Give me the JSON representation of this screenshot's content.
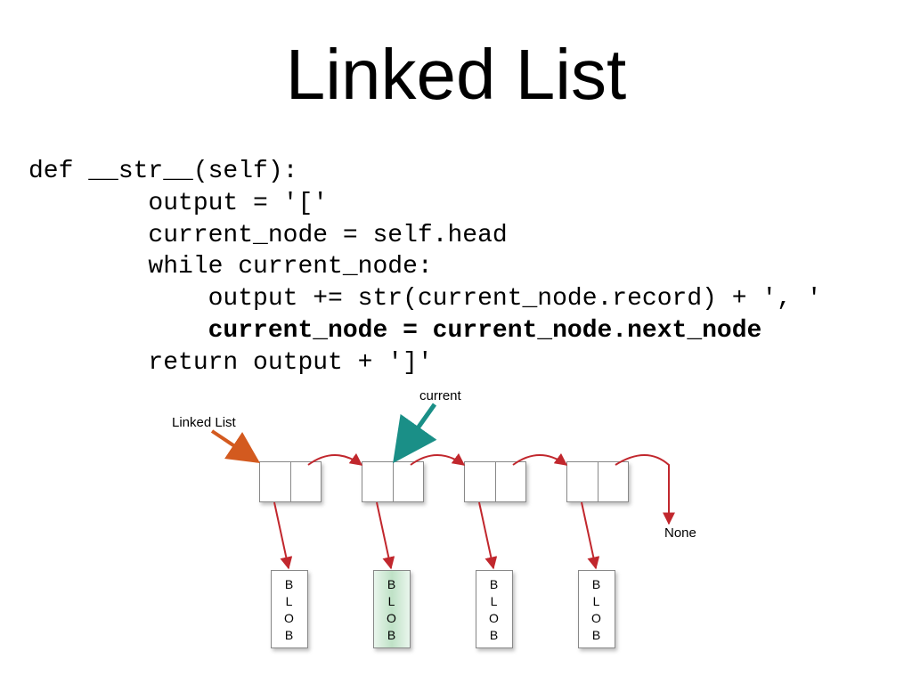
{
  "title": "Linked List",
  "code": {
    "l1": "def __str__(self):",
    "l2": "        output = '['",
    "l3": "        current_node = self.head",
    "l4": "        while current_node:",
    "l5": "            output += str(current_node.record) + ', '",
    "l6": "            current_node = current_node.next_node",
    "l7": "        return output + ']'"
  },
  "diagram": {
    "labels": {
      "linked_list": "Linked List",
      "current": "current",
      "none": "None"
    },
    "blob": {
      "c1": "B",
      "c2": "L",
      "c3": "O",
      "c4": "B"
    }
  }
}
